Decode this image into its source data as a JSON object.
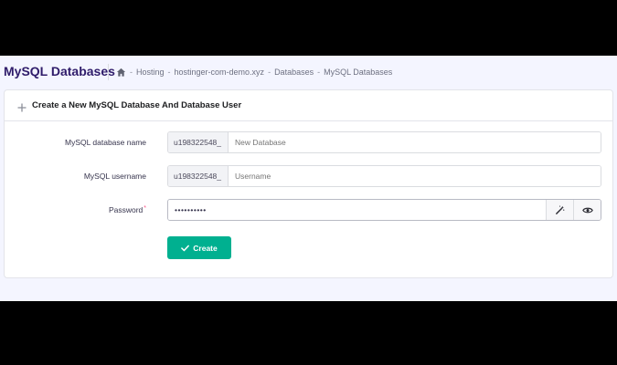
{
  "header": {
    "title": "MySQL Databases",
    "breadcrumb": [
      {
        "label": "Hosting"
      },
      {
        "label": "hostinger-com-demo.xyz"
      },
      {
        "label": "Databases"
      },
      {
        "label": "MySQL Databases"
      }
    ],
    "separator": "-"
  },
  "card": {
    "title": "Create a New MySQL Database And Database User"
  },
  "form": {
    "db_name": {
      "label": "MySQL database name",
      "prefix": "u198322548_",
      "placeholder": "New Database"
    },
    "username": {
      "label": "MySQL username",
      "prefix": "u198322548_",
      "placeholder": "Username"
    },
    "password": {
      "label": "Password",
      "required_mark": "*",
      "value": "••••••••••"
    },
    "create_label": "Create"
  },
  "colors": {
    "brand_title": "#2f1c6a",
    "accent_button": "#00b090",
    "page_background": "#f4f5ff"
  },
  "icons": [
    "home-icon",
    "plus-icon",
    "magic-wand-icon",
    "eye-icon",
    "check-icon"
  ]
}
